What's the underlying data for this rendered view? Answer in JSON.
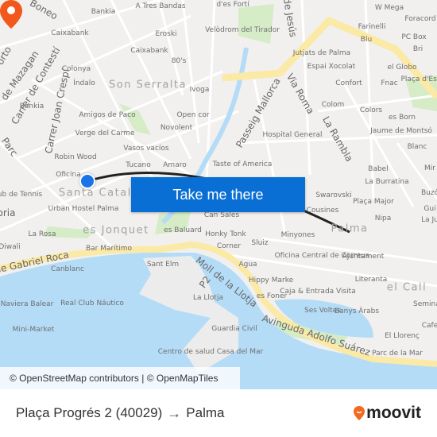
{
  "map": {
    "labels": [
      "Bankia",
      "A Tres Bandas",
      "d'es Fortí",
      "Caixabank",
      "Eroski",
      "Velòdrom del Tirador",
      "Caixabank",
      "80's",
      "Colonya",
      "Índalo",
      "Son Serralta",
      "Ivoga",
      "Bankia",
      "Amigos de Paco",
      "Open cor",
      "Novolent",
      "Verge del Carme",
      "Vasos vacíos",
      "Robin Wood",
      "Tucano",
      "Amaro",
      "Oficina",
      "Santa Catalina",
      "ub de Tennis",
      "Urban Hostel Palma",
      "es Jonquet",
      "es Baluard",
      "Can Sales",
      "Honky Tonk",
      "La Rosa",
      "Diwali",
      "Bar Marítimo",
      "Canblanc",
      "Sant Elm",
      "Corner",
      "Sluiz",
      "Agua",
      "Hippy Marke",
      "La Llotja",
      "P2",
      "Real Club Náutico",
      "na Naviera Balear",
      "Mini-Market",
      "Guardia Civil",
      "Centro de salud Casa del Mar",
      "Jutjats de Palma",
      "Espai Xocolat",
      "el Globo",
      "Confort",
      "Fnac",
      "Colom",
      "Colors",
      "es Born",
      "Jaume de Montsó",
      "Blanc",
      "Hospital General",
      "Taste of America",
      "Babel",
      "La Burratina",
      "W Mega",
      "Farinelli",
      "Blu",
      "PC Box",
      "Bri",
      "Foracord",
      "Plaça d'Esp",
      "Swarovski",
      "Plaça Major",
      "Cousines",
      "Nipa",
      "Palma",
      "Minyones",
      "Oficina Central de Correus",
      "Ajuntament",
      "Caja & Entrada Visita",
      "es Foner",
      "Ses Voltes",
      "Banys Àrabs",
      "Literanta",
      "el Call",
      "Seminari",
      "El Llorenç",
      "Cafe",
      "Parc de la Mar",
      "Buzó",
      "Gui",
      "La Ju",
      "Mir"
    ],
    "streets": [
      "Boneo",
      "orto",
      "de Mazagan",
      "Carrer de Contestí",
      "Carrer Joan Crespí",
      "Parc",
      "oria",
      "de Jesús",
      "Via Roma",
      "La Rambla",
      "Passeig Mallorca",
      "de Gabriel Roca",
      "Moll de la Llotja",
      "Avinguda Adolfo Suárez"
    ],
    "cta_label": "Take me there",
    "attribution": "© OpenStreetMap contributors | © OpenMapTiles",
    "colors": {
      "water": "#b4dcf7",
      "land": "#f1f0ee",
      "road": "#fbe9a6",
      "accent": "#0a6fd4",
      "origin": "#1a73e8",
      "destination": "#f2581b"
    },
    "icons": {
      "origin": "origin-dot",
      "destination": "map-pin"
    }
  },
  "footer": {
    "origin": "Plaça Progrés 2 (40029)",
    "arrow": "→",
    "destination": "Palma",
    "brand": "moovit"
  }
}
